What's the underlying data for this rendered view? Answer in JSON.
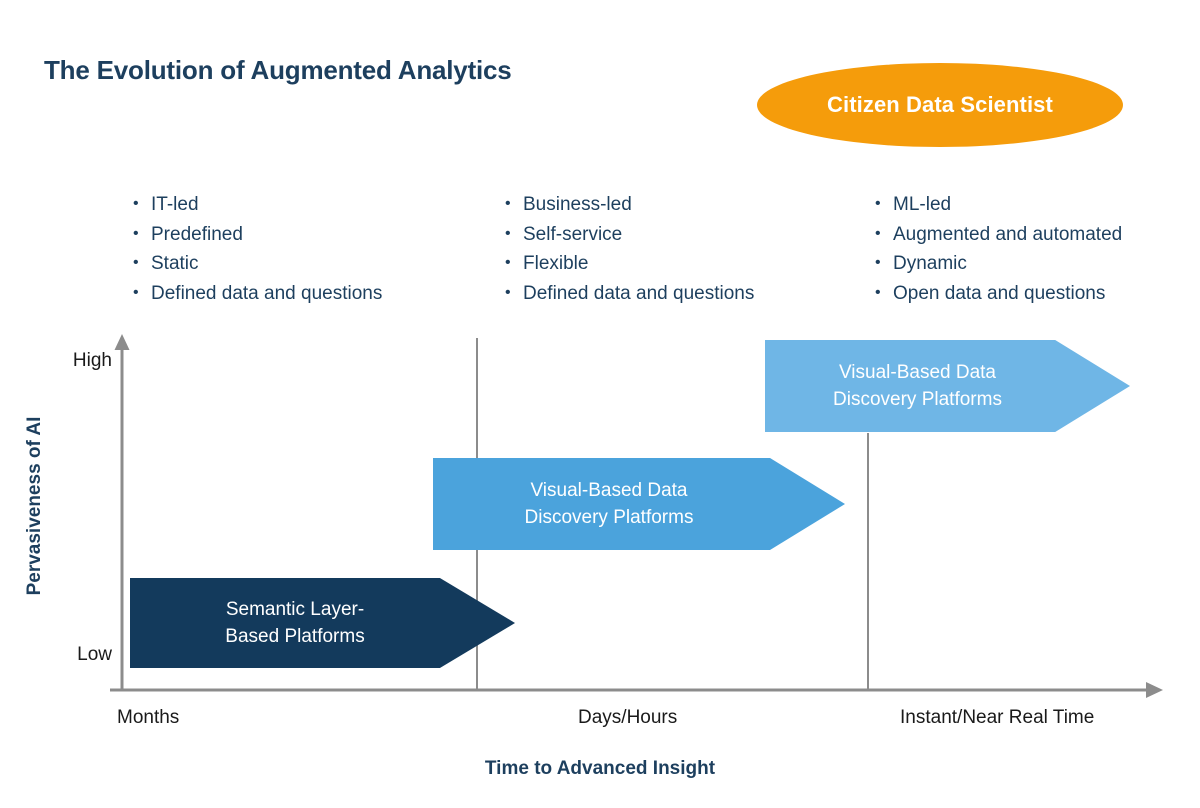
{
  "title": "The Evolution of Augmented Analytics",
  "badge": {
    "label": "Citizen Data Scientist",
    "color": "#F59C0B",
    "text_color": "#FFFFFF"
  },
  "columns": [
    {
      "name": "it-led-column",
      "bullets": [
        "IT-led",
        "Predefined",
        "Static",
        "Defined data and questions"
      ]
    },
    {
      "name": "business-led-column",
      "bullets": [
        "Business-led",
        "Self-service",
        "Flexible",
        "Defined data and questions"
      ]
    },
    {
      "name": "ml-led-column",
      "bullets": [
        "ML-led",
        "Augmented and automated",
        "Dynamic",
        "Open data and questions"
      ]
    }
  ],
  "chart_data": {
    "type": "bar",
    "title": "The Evolution of Augmented Analytics",
    "xlabel": "Time to Advanced Insight",
    "ylabel": "Pervasiveness of AI",
    "x_ticks": [
      "Months",
      "Days/Hours",
      "Instant/Near Real Time"
    ],
    "y_ticks": [
      "Low",
      "High"
    ],
    "ylim": [
      "Low",
      "High"
    ],
    "grid": "two vertical separators at Days/Hours and Instant/Near Real Time",
    "legend": "none",
    "axis_color": "#8C8C8C",
    "categories": [
      "Months",
      "Days/Hours",
      "Instant/Near Real Time"
    ],
    "series": [
      {
        "name": "Semantic Layer-Based Platforms",
        "label_line1": "Semantic Layer-",
        "label_line2": "Based Platforms",
        "color": "#133A5C",
        "x_start": "Months",
        "x_end": "Days/Hours",
        "y_level": "Low",
        "y_value": 1
      },
      {
        "name": "Visual-Based Data Discovery Platforms",
        "label_line1": "Visual-Based Data",
        "label_line2": "Discovery Platforms",
        "color": "#4BA3DC",
        "x_start": "Days/Hours",
        "x_end": "Instant/Near Real Time",
        "y_level": "Medium",
        "y_value": 2
      },
      {
        "name": "Visual-Based Data Discovery Platforms",
        "label_line1": "Visual-Based Data",
        "label_line2": "Discovery Platforms",
        "color": "#6FB6E6",
        "x_start": "Instant/Near Real Time",
        "x_end": "beyond",
        "y_level": "High",
        "y_value": 3
      }
    ]
  }
}
